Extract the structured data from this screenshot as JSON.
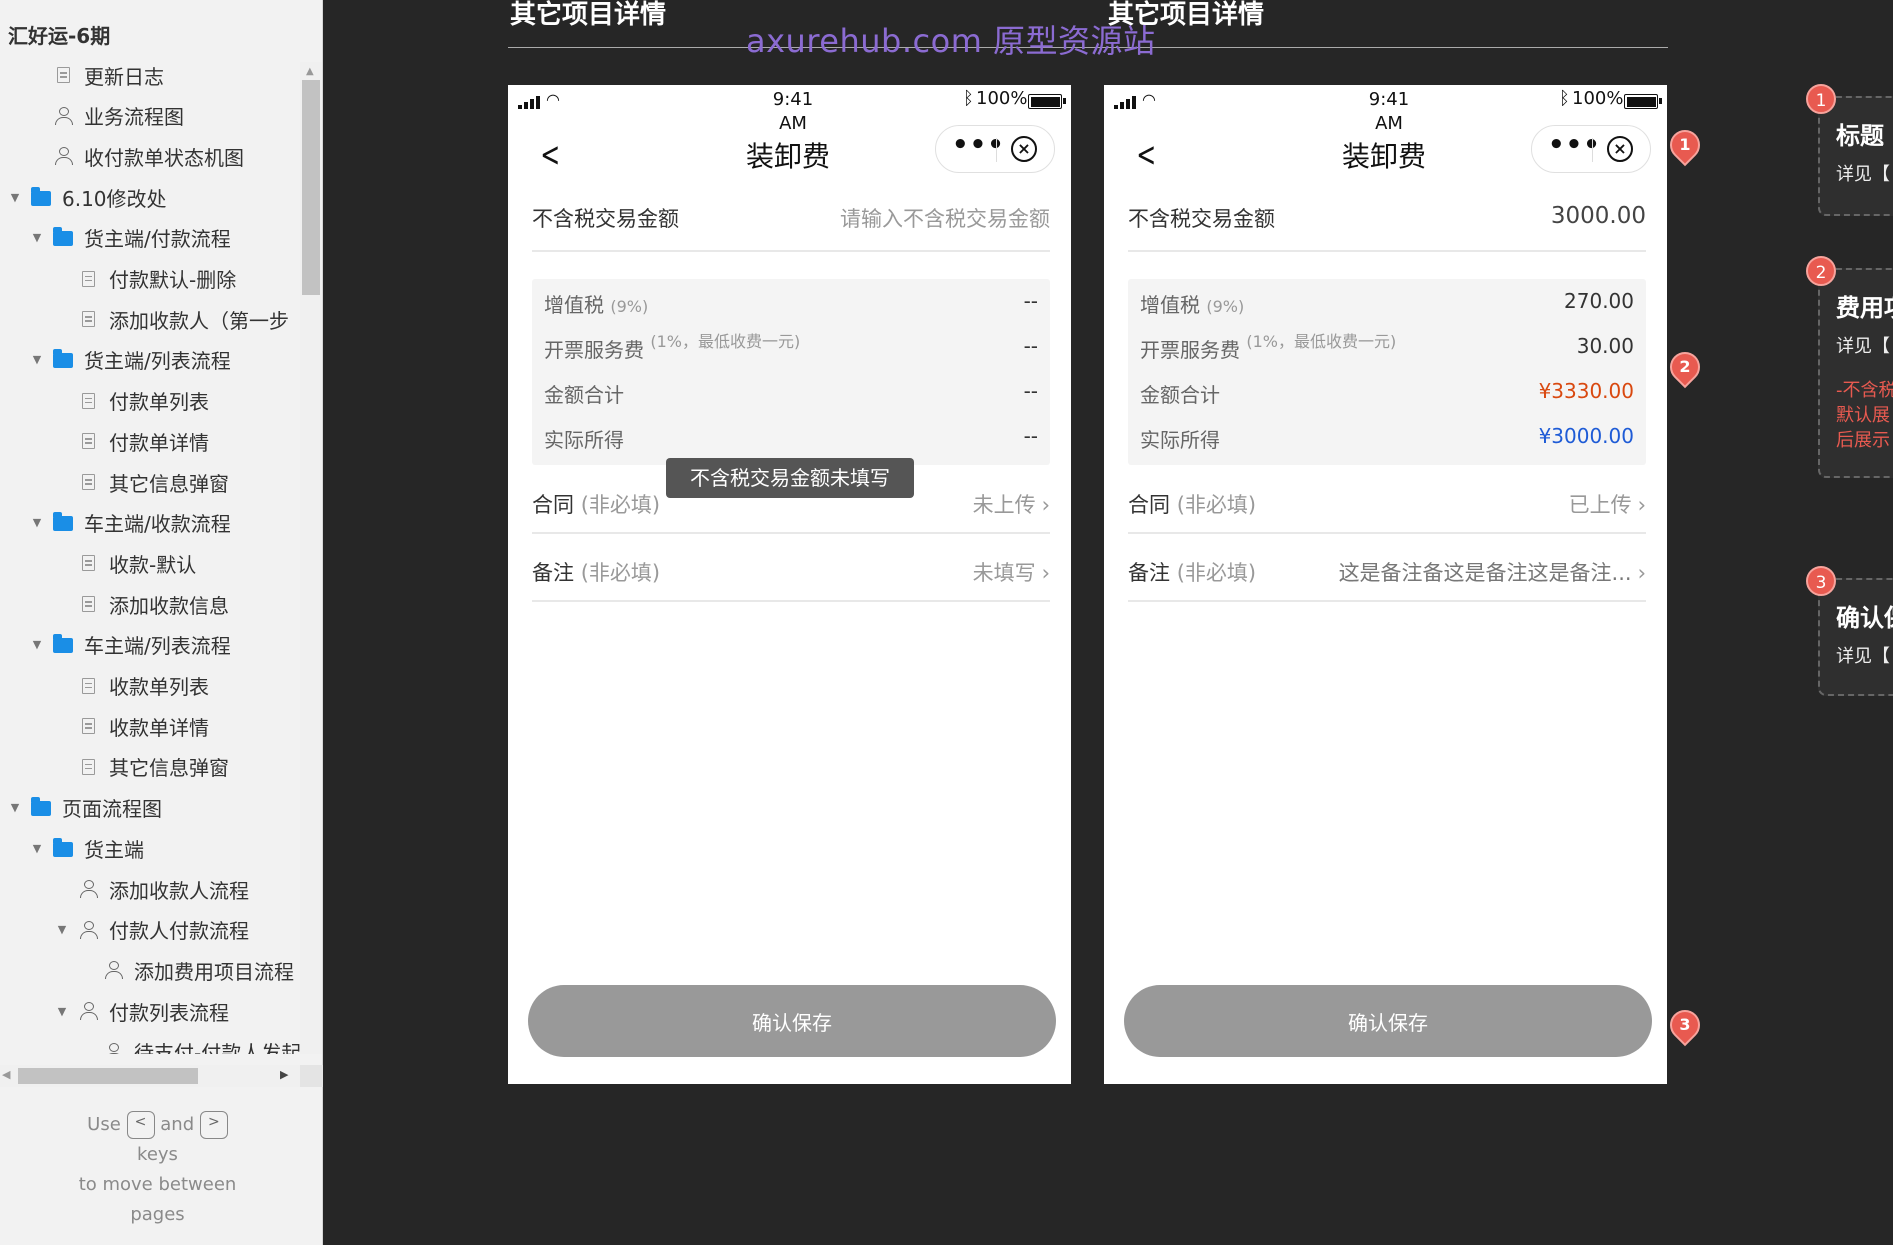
{
  "sidebar": {
    "project_title": "汇好运-6期",
    "items": [
      {
        "label": "更新日志",
        "icon": "page-icon",
        "level": 1,
        "expand": ""
      },
      {
        "label": "业务流程图",
        "icon": "flow-icon",
        "level": 1,
        "expand": ""
      },
      {
        "label": "收付款单状态机图",
        "icon": "flow-icon",
        "level": 1,
        "expand": ""
      },
      {
        "label": "6.10修改处",
        "icon": "folder-icon",
        "level": 0,
        "expand": "▼"
      },
      {
        "label": "货主端/付款流程",
        "icon": "folder-icon",
        "level": 1,
        "expand": "▼"
      },
      {
        "label": "付款默认-删除",
        "icon": "page-icon",
        "level": 2,
        "expand": ""
      },
      {
        "label": "添加收款人（第一步",
        "icon": "page-icon",
        "level": 2,
        "expand": ""
      },
      {
        "label": "货主端/列表流程",
        "icon": "folder-icon",
        "level": 1,
        "expand": "▼"
      },
      {
        "label": "付款单列表",
        "icon": "page-icon",
        "level": 2,
        "expand": ""
      },
      {
        "label": "付款单详情",
        "icon": "page-icon",
        "level": 2,
        "expand": ""
      },
      {
        "label": "其它信息弹窗",
        "icon": "page-icon",
        "level": 2,
        "expand": ""
      },
      {
        "label": "车主端/收款流程",
        "icon": "folder-icon",
        "level": 1,
        "expand": "▼"
      },
      {
        "label": "收款-默认",
        "icon": "page-icon",
        "level": 2,
        "expand": ""
      },
      {
        "label": "添加收款信息",
        "icon": "page-icon",
        "level": 2,
        "expand": ""
      },
      {
        "label": "车主端/列表流程",
        "icon": "folder-icon",
        "level": 1,
        "expand": "▼"
      },
      {
        "label": "收款单列表",
        "icon": "page-icon",
        "level": 2,
        "expand": ""
      },
      {
        "label": "收款单详情",
        "icon": "page-icon",
        "level": 2,
        "expand": ""
      },
      {
        "label": "其它信息弹窗",
        "icon": "page-icon",
        "level": 2,
        "expand": ""
      },
      {
        "label": "页面流程图",
        "icon": "folder-icon",
        "level": 0,
        "expand": "▼"
      },
      {
        "label": "货主端",
        "icon": "folder-icon",
        "level": 1,
        "expand": "▼"
      },
      {
        "label": "添加收款人流程",
        "icon": "flow-icon",
        "level": 2,
        "expand": ""
      },
      {
        "label": "付款人付款流程",
        "icon": "flow-icon",
        "level": 2,
        "expand": "▼"
      },
      {
        "label": "添加费用项目流程",
        "icon": "flow-icon",
        "level": 3,
        "expand": ""
      },
      {
        "label": "付款列表流程",
        "icon": "flow-icon",
        "level": 2,
        "expand": "▼"
      },
      {
        "label": "待支付-付款人发起",
        "icon": "flow-icon",
        "level": 3,
        "expand": ""
      }
    ],
    "nav_hint": {
      "use": "Use",
      "key_prev": "<",
      "and": "and",
      "key_next": ">",
      "keys": "keys",
      "line2": "to move between",
      "line3": "pages"
    }
  },
  "canvas": {
    "watermark": "axurehub.com 原型资源站",
    "section_titles": [
      "其它项目详情",
      "其它项目详情"
    ],
    "phones": [
      {
        "status": {
          "time": "9:41\nAM",
          "battery": "100%"
        },
        "nav_title": "装卸费",
        "amount_label": "不含税交易金额",
        "amount_value": "请输入不含税交易金额",
        "vat_label": "增值税",
        "vat_sub": "(9%)",
        "vat_value": "--",
        "fee_label": "开票服务费",
        "fee_sub": "(1%，最低收费一元)",
        "fee_value": "--",
        "total_label": "金额合计",
        "total_value": "--",
        "net_label": "实际所得",
        "net_value": "--",
        "contract_label": "合同",
        "contract_sub": "(非必填)",
        "contract_value": "未上传",
        "remark_label": "备注",
        "remark_sub": "(非必填)",
        "remark_value": "未填写",
        "toast": "不含税交易金额未填写",
        "save_label": "确认保存"
      },
      {
        "status": {
          "time": "9:41\nAM",
          "battery": "100%"
        },
        "nav_title": "装卸费",
        "amount_label": "不含税交易金额",
        "amount_value": "3000.00",
        "vat_label": "增值税",
        "vat_sub": "(9%)",
        "vat_value": "270.00",
        "fee_label": "开票服务费",
        "fee_sub": "(1%，最低收费一元)",
        "fee_value": "30.00",
        "total_label": "金额合计",
        "total_value": "¥3330.00",
        "net_label": "实际所得",
        "net_value": "¥3000.00",
        "contract_label": "合同",
        "contract_sub": "(非必填)",
        "contract_value": "已上传",
        "remark_label": "备注",
        "remark_sub": "(非必填)",
        "remark_value": "这是备注备这是备注这是备注...",
        "save_label": "确认保存"
      }
    ],
    "markers": [
      "1",
      "2",
      "3"
    ],
    "notes": [
      {
        "badge": "1",
        "title": "标题",
        "text": "详见【"
      },
      {
        "badge": "2",
        "title": "费用项",
        "text": "详见【",
        "red_lines": [
          "-不含税",
          "默认展",
          "后展示"
        ]
      },
      {
        "badge": "3",
        "title": "确认保",
        "text": "详见【"
      }
    ]
  },
  "colors": {
    "accent_red": "#d9480f",
    "accent_blue": "#1e5bd6",
    "marker": "#e85a50",
    "folder": "#1a8ee6"
  }
}
